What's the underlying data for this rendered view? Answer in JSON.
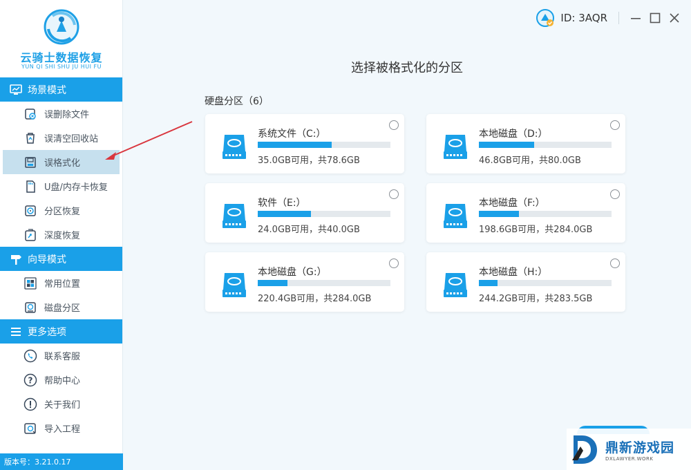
{
  "app": {
    "logo_text": "云骑士数据恢复",
    "logo_sub": "YUN QI SHI SHU JU HUI FU",
    "version": "版本号：3.21.0.17"
  },
  "sidebar": {
    "sections": [
      {
        "title": "场景模式",
        "icon": "monitor-icon",
        "items": [
          {
            "label": "误删除文件",
            "icon": "delete-file-icon"
          },
          {
            "label": "误清空回收站",
            "icon": "recycle-bin-icon"
          },
          {
            "label": "误格式化",
            "icon": "format-disk-icon",
            "active": true
          },
          {
            "label": "U盘/内存卡恢复",
            "icon": "sd-card-icon"
          },
          {
            "label": "分区恢复",
            "icon": "partition-icon"
          },
          {
            "label": "深度恢复",
            "icon": "deep-recover-icon"
          }
        ]
      },
      {
        "title": "向导模式",
        "icon": "signpost-icon",
        "items": [
          {
            "label": "常用位置",
            "icon": "windows-icon"
          },
          {
            "label": "磁盘分区",
            "icon": "disk-partition-icon"
          }
        ]
      },
      {
        "title": "更多选项",
        "icon": "menu-lines-icon",
        "items": [
          {
            "label": "联系客服",
            "icon": "phone-icon"
          },
          {
            "label": "帮助中心",
            "icon": "help-icon"
          },
          {
            "label": "关于我们",
            "icon": "info-icon"
          },
          {
            "label": "导入工程",
            "icon": "import-icon"
          }
        ]
      }
    ]
  },
  "topbar": {
    "id_text": "ID: 3AQR"
  },
  "main": {
    "title": "选择被格式化的分区",
    "group_label": "硬盘分区（6）",
    "partitions": [
      {
        "name": "系统文件（C:）",
        "info": "35.0GB可用，共78.6GB",
        "used_fraction": 0.555
      },
      {
        "name": "本地磁盘（D:）",
        "info": "46.8GB可用，共80.0GB",
        "used_fraction": 0.415
      },
      {
        "name": "软件（E:）",
        "info": "24.0GB可用，共40.0GB",
        "used_fraction": 0.4
      },
      {
        "name": "本地磁盘（F:）",
        "info": "198.6GB可用，共284.0GB",
        "used_fraction": 0.3
      },
      {
        "name": "本地磁盘（G:）",
        "info": "220.4GB可用，共284.0GB",
        "used_fraction": 0.224
      },
      {
        "name": "本地磁盘（H:）",
        "info": "244.2GB可用，共283.5GB",
        "used_fraction": 0.139
      }
    ]
  },
  "watermark": {
    "big": "鼎新游戏园",
    "small": "DXLAWYER.WORK"
  },
  "colors": {
    "accent": "#1aa0e8",
    "active_bg": "#c6e0ee",
    "arrow": "#d9363e"
  }
}
